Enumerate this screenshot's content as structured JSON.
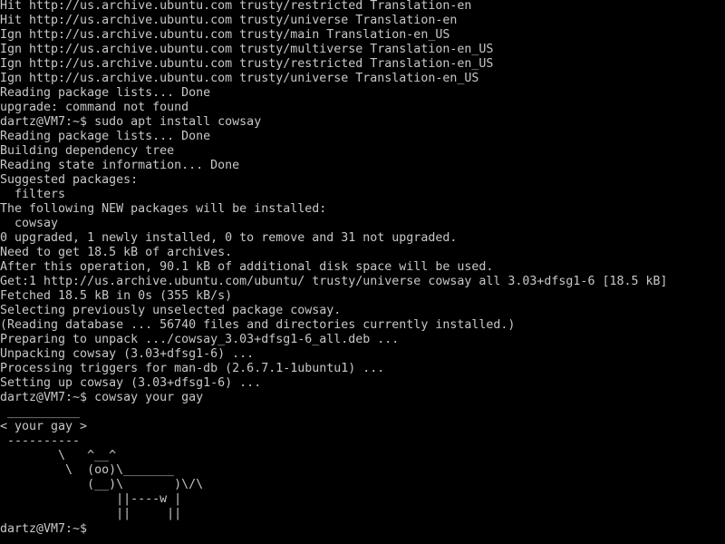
{
  "terminal": {
    "lines": [
      "Hit http://us.archive.ubuntu.com trusty/restricted Translation-en",
      "Hit http://us.archive.ubuntu.com trusty/universe Translation-en",
      "Ign http://us.archive.ubuntu.com trusty/main Translation-en_US",
      "Ign http://us.archive.ubuntu.com trusty/multiverse Translation-en_US",
      "Ign http://us.archive.ubuntu.com trusty/restricted Translation-en_US",
      "Ign http://us.archive.ubuntu.com trusty/universe Translation-en_US",
      "Reading package lists... Done",
      "upgrade: command not found",
      "dartz@VM7:~$ sudo apt install cowsay",
      "Reading package lists... Done",
      "Building dependency tree",
      "Reading state information... Done",
      "Suggested packages:",
      "  filters",
      "The following NEW packages will be installed:",
      "  cowsay",
      "0 upgraded, 1 newly installed, 0 to remove and 31 not upgraded.",
      "Need to get 18.5 kB of archives.",
      "After this operation, 90.1 kB of additional disk space will be used.",
      "Get:1 http://us.archive.ubuntu.com/ubuntu/ trusty/universe cowsay all 3.03+dfsg1-6 [18.5 kB]",
      "Fetched 18.5 kB in 0s (355 kB/s)",
      "Selecting previously unselected package cowsay.",
      "(Reading database ... 56740 files and directories currently installed.)",
      "Preparing to unpack .../cowsay_3.03+dfsg1-6_all.deb ...",
      "Unpacking cowsay (3.03+dfsg1-6) ...",
      "Processing triggers for man-db (2.6.7.1-1ubuntu1) ...",
      "Setting up cowsay (3.03+dfsg1-6) ...",
      "dartz@VM7:~$ cowsay your gay",
      " __________",
      "< your gay >",
      " ----------",
      "        \\   ^__^",
      "         \\  (oo)\\_______",
      "            (__)\\       )\\/\\",
      "                ||----w |",
      "                ||     ||"
    ],
    "prompt": "dartz@VM7:~$ ",
    "colors": {
      "background": "#000000",
      "foreground": "#c8c8c8"
    }
  }
}
